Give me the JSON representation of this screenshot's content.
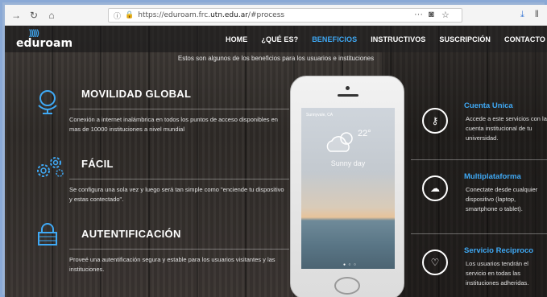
{
  "browser": {
    "url_prefix": "https://eduroam.frc.",
    "url_domain": "utn.edu.ar",
    "url_suffix": "/#process",
    "menu_dots": "···"
  },
  "site": {
    "logo": "eduroam",
    "nav": [
      "HOME",
      "¿QUÉ ES?",
      "BENEFICIOS",
      "INSTRUCTIVOS",
      "SUSCRIPCIÓN",
      "CONTACTO"
    ],
    "active_nav": "BENEFICIOS",
    "intro": "Estos son algunos de los beneficios para los usuarios e instituciones",
    "features_left": [
      {
        "title": "MOVILIDAD GLOBAL",
        "text": "Conexión a internet inalámbrica en todos los puntos de acceso disponibles en mas de 10000 instituciones a nivel mundial",
        "icon": "globe-icon"
      },
      {
        "title": "FÁCIL",
        "text": "Se configura una sola vez y luego será tan simple como \"enciende tu dispositivo y estas contectado\".",
        "icon": "gears-icon"
      },
      {
        "title": "AUTENTIFICACIÓN",
        "text": "Proveé una autentificación segura y estable para los usuarios visitantes y las instituciones.",
        "icon": "lock-icon"
      }
    ],
    "features_right": [
      {
        "title": "Cuenta Unica",
        "text": "Accede a este servicios con la cuenta institucional de tu universidad.",
        "icon": "key-icon"
      },
      {
        "title": "Multiplataforma",
        "text": "Conectate desde cualquier dispositivo (laptop, smartphone o tablet).",
        "icon": "cloud-icon"
      },
      {
        "title": "Servicio Reciproco",
        "text": "Los usuarios tendrán el servicio en todas las instituciones adheridas.",
        "icon": "heart-icon"
      }
    ],
    "phone": {
      "city": "Sunnyvale, CA",
      "temp": "22°",
      "condition": "Sunny day"
    }
  }
}
